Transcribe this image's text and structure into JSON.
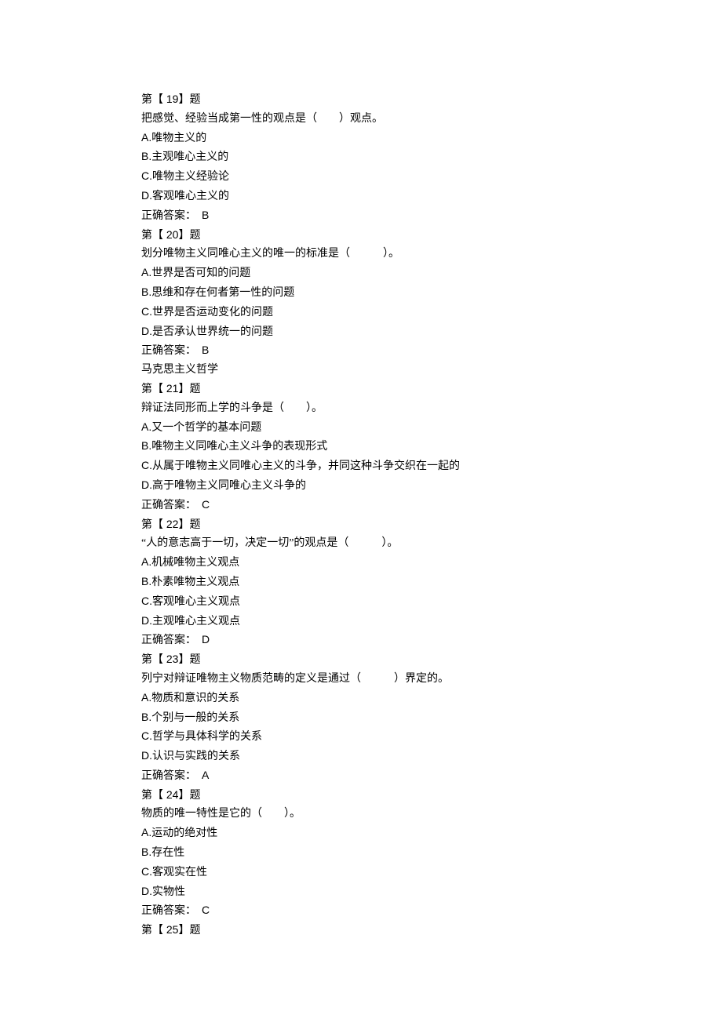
{
  "questions": [
    {
      "header_pre": "第【",
      "header_num": " 19",
      "header_post": "】题",
      "stem": "把感觉、经验当成第一性的观点是（　　）观点。",
      "opts": [
        {
          "letter": "A.",
          "text": "唯物主义的"
        },
        {
          "letter": "B.",
          "text": "主观唯心主义的"
        },
        {
          "letter": "C.",
          "text": "唯物主义经验论"
        },
        {
          "letter": "D.",
          "text": "客观唯心主义的"
        }
      ],
      "ans_label": "正确答案：",
      "ans_val": "B"
    },
    {
      "header_pre": "第【",
      "header_num": " 20",
      "header_post": "】题",
      "stem": "划分唯物主义同唯心主义的唯一的标准是（　　　）。",
      "opts": [
        {
          "letter": "A.",
          "text": "世界是否可知的问题"
        },
        {
          "letter": "B.",
          "text": "思维和存在何者第一性的问题"
        },
        {
          "letter": "C.",
          "text": "世界是否运动变化的问题"
        },
        {
          "letter": "D.",
          "text": "是否承认世界统一的问题"
        }
      ],
      "ans_label": "正确答案：",
      "ans_val": "B",
      "trailer": "马克思主义哲学"
    },
    {
      "header_pre": "第【",
      "header_num": " 21",
      "header_post": "】题",
      "stem": "辩证法同形而上学的斗争是（　　）。",
      "opts": [
        {
          "letter": "A.",
          "text": "又一个哲学的基本问题"
        },
        {
          "letter": "B.",
          "text": "唯物主义同唯心主义斗争的表现形式"
        },
        {
          "letter": "C.",
          "text": "从属于唯物主义同唯心主义的斗争，并同这种斗争交织在一起的"
        },
        {
          "letter": "D.",
          "text": "高于唯物主义同唯心主义斗争的"
        }
      ],
      "ans_label": "正确答案：",
      "ans_val": "C"
    },
    {
      "header_pre": "第【",
      "header_num": " 22",
      "header_post": "】题",
      "stem": "“人的意志高于一切，决定一切”的观点是（　　　）。",
      "opts": [
        {
          "letter": "A.",
          "text": "机械唯物主义观点"
        },
        {
          "letter": "B.",
          "text": "朴素唯物主义观点"
        },
        {
          "letter": "C.",
          "text": "客观唯心主义观点"
        },
        {
          "letter": "D.",
          "text": "主观唯心主义观点"
        }
      ],
      "ans_label": "正确答案：",
      "ans_val": "D"
    },
    {
      "header_pre": "第【",
      "header_num": " 23",
      "header_post": "】题",
      "stem": "列宁对辩证唯物主义物质范畴的定义是通过（　　　）界定的。",
      "opts": [
        {
          "letter": "A.",
          "text": "物质和意识的关系"
        },
        {
          "letter": "B.",
          "text": "个别与一般的关系"
        },
        {
          "letter": "C.",
          "text": "哲学与具体科学的关系"
        },
        {
          "letter": "D.",
          "text": "认识与实践的关系"
        }
      ],
      "ans_label": "正确答案：",
      "ans_val": "A"
    },
    {
      "header_pre": "第【",
      "header_num": " 24",
      "header_post": "】题",
      "stem": "物质的唯一特性是它的（　　）。",
      "opts": [
        {
          "letter": "A.",
          "text": "运动的绝对性"
        },
        {
          "letter": "B.",
          "text": "存在性"
        },
        {
          "letter": "C.",
          "text": "客观实在性"
        },
        {
          "letter": "D.",
          "text": "实物性"
        }
      ],
      "ans_label": "正确答案：",
      "ans_val": "C"
    },
    {
      "header_pre": "第【",
      "header_num": " 25",
      "header_post": "】题"
    }
  ]
}
